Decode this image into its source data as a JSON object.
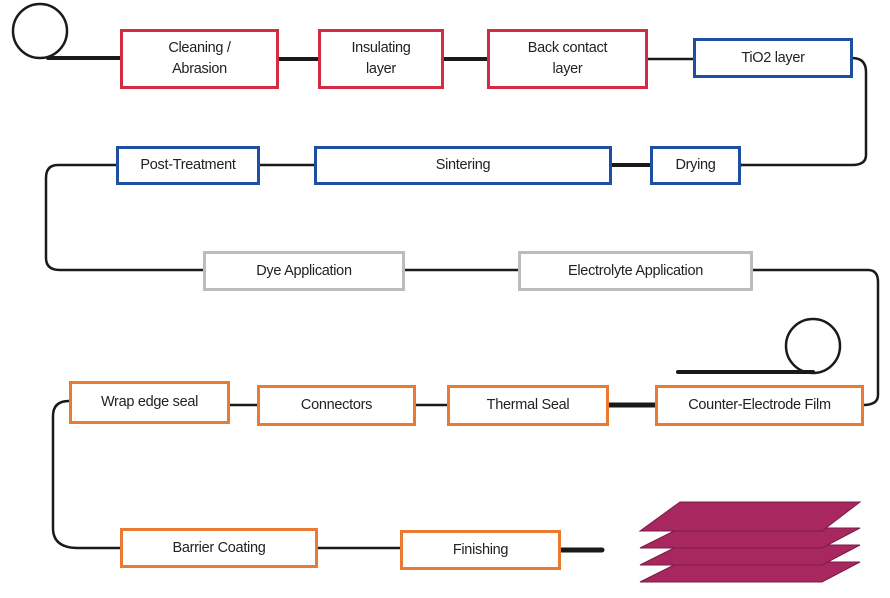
{
  "colors": {
    "stage1": "#d42a44",
    "stage2": "#1f4fa3",
    "stage3": "#bcbcbc",
    "stage4": "#ea7a32",
    "product": "#a8275e",
    "line": "#1a1a1a"
  },
  "steps": [
    {
      "label": "Cleaning /\nAbrasion"
    },
    {
      "label": "Insulating\nlayer"
    },
    {
      "label": "Back contact\nlayer"
    },
    {
      "label": "TiO2 layer"
    },
    {
      "label": "Drying"
    },
    {
      "label": "Sintering"
    },
    {
      "label": "Post-Treatment"
    },
    {
      "label": "Dye Application"
    },
    {
      "label": "Electrolyte Application"
    },
    {
      "label": "Counter-Electrode Film"
    },
    {
      "label": "Thermal Seal"
    },
    {
      "label": "Connectors"
    },
    {
      "label": "Wrap edge seal"
    },
    {
      "label": "Barrier Coating"
    },
    {
      "label": "Finishing"
    }
  ],
  "icons": {
    "input_roll": "film-roll-icon",
    "counter_roll": "film-roll-icon",
    "output": "stacked-sheets-icon"
  }
}
